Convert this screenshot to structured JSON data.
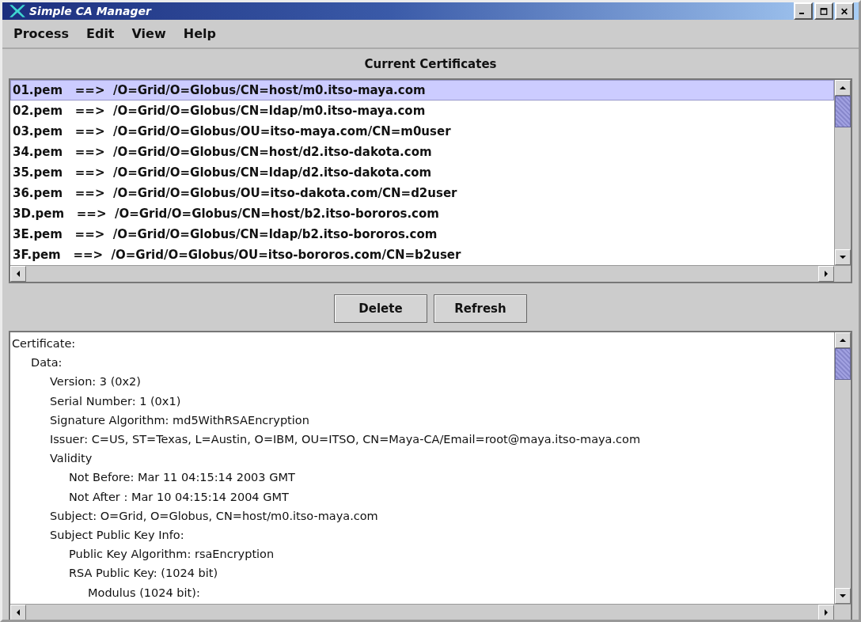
{
  "window": {
    "title": "Simple CA Manager"
  },
  "menu": [
    "Process",
    "Edit",
    "View",
    "Help"
  ],
  "list_title": "Current Certificates",
  "certificates": [
    {
      "text": "01.pem   ==>  /O=Grid/O=Globus/CN=host/m0.itso-maya.com",
      "selected": true
    },
    {
      "text": "02.pem   ==>  /O=Grid/O=Globus/CN=ldap/m0.itso-maya.com",
      "selected": false
    },
    {
      "text": "03.pem   ==>  /O=Grid/O=Globus/OU=itso-maya.com/CN=m0user",
      "selected": false
    },
    {
      "text": "34.pem   ==>  /O=Grid/O=Globus/CN=host/d2.itso-dakota.com",
      "selected": false
    },
    {
      "text": "35.pem   ==>  /O=Grid/O=Globus/CN=ldap/d2.itso-dakota.com",
      "selected": false
    },
    {
      "text": "36.pem   ==>  /O=Grid/O=Globus/OU=itso-dakota.com/CN=d2user",
      "selected": false
    },
    {
      "text": "3D.pem   ==>  /O=Grid/O=Globus/CN=host/b2.itso-bororos.com",
      "selected": false
    },
    {
      "text": "3E.pem   ==>  /O=Grid/O=Globus/CN=ldap/b2.itso-bororos.com",
      "selected": false
    },
    {
      "text": "3F.pem   ==>  /O=Grid/O=Globus/OU=itso-bororos.com/CN=b2user",
      "selected": false
    }
  ],
  "buttons": [
    "Delete",
    "Refresh"
  ],
  "details": [
    {
      "text": "Certificate:",
      "children": [
        {
          "text": "Data:",
          "children": [
            {
              "text": "Version: 3 (0x2)"
            },
            {
              "text": "Serial Number: 1 (0x1)"
            },
            {
              "text": "Signature Algorithm: md5WithRSAEncryption"
            },
            {
              "text": "Issuer: C=US, ST=Texas, L=Austin, O=IBM, OU=ITSO, CN=Maya-CA/Email=root@maya.itso-maya.com"
            },
            {
              "text": "Validity",
              "children": [
                {
                  "text": "Not Before: Mar 11 04:15:14 2003 GMT"
                },
                {
                  "text": "Not After : Mar 10 04:15:14 2004 GMT"
                }
              ]
            },
            {
              "text": "Subject: O=Grid, O=Globus, CN=host/m0.itso-maya.com"
            },
            {
              "text": "Subject Public Key Info:",
              "children": [
                {
                  "text": "Public Key Algorithm: rsaEncryption"
                },
                {
                  "text": "RSA Public Key: (1024 bit)",
                  "children": [
                    {
                      "text": "Modulus (1024 bit):"
                    }
                  ]
                }
              ]
            }
          ]
        }
      ]
    }
  ]
}
